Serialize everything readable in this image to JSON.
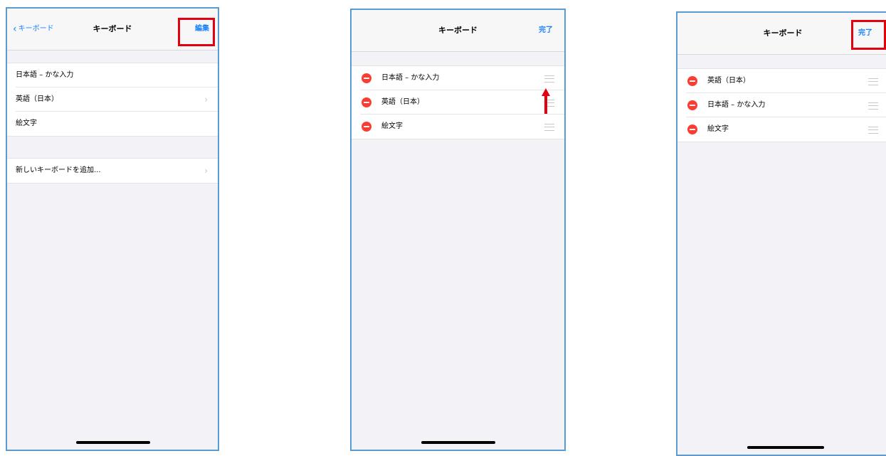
{
  "colors": {
    "accent": "#1a82fb",
    "delete": "#ff3b30",
    "highlight": "#e3000f",
    "frame": "#5b9bd5"
  },
  "screen1": {
    "back_label": "キーボード",
    "title": "キーボード",
    "edit_label": "編集",
    "keyboards": [
      {
        "label": "日本語 – かな入力"
      },
      {
        "label": "英語（日本）"
      },
      {
        "label": "絵文字"
      }
    ],
    "add_label": "新しいキーボードを追加..."
  },
  "screen2": {
    "title": "キーボード",
    "done_label": "完了",
    "keyboards": [
      {
        "label": "日本語 – かな入力"
      },
      {
        "label": "英語（日本）"
      },
      {
        "label": "絵文字"
      }
    ]
  },
  "screen3": {
    "title": "キーボード",
    "done_label": "完了",
    "keyboards": [
      {
        "label": "英語（日本）"
      },
      {
        "label": "日本語 – かな入力"
      },
      {
        "label": "絵文字"
      }
    ]
  }
}
